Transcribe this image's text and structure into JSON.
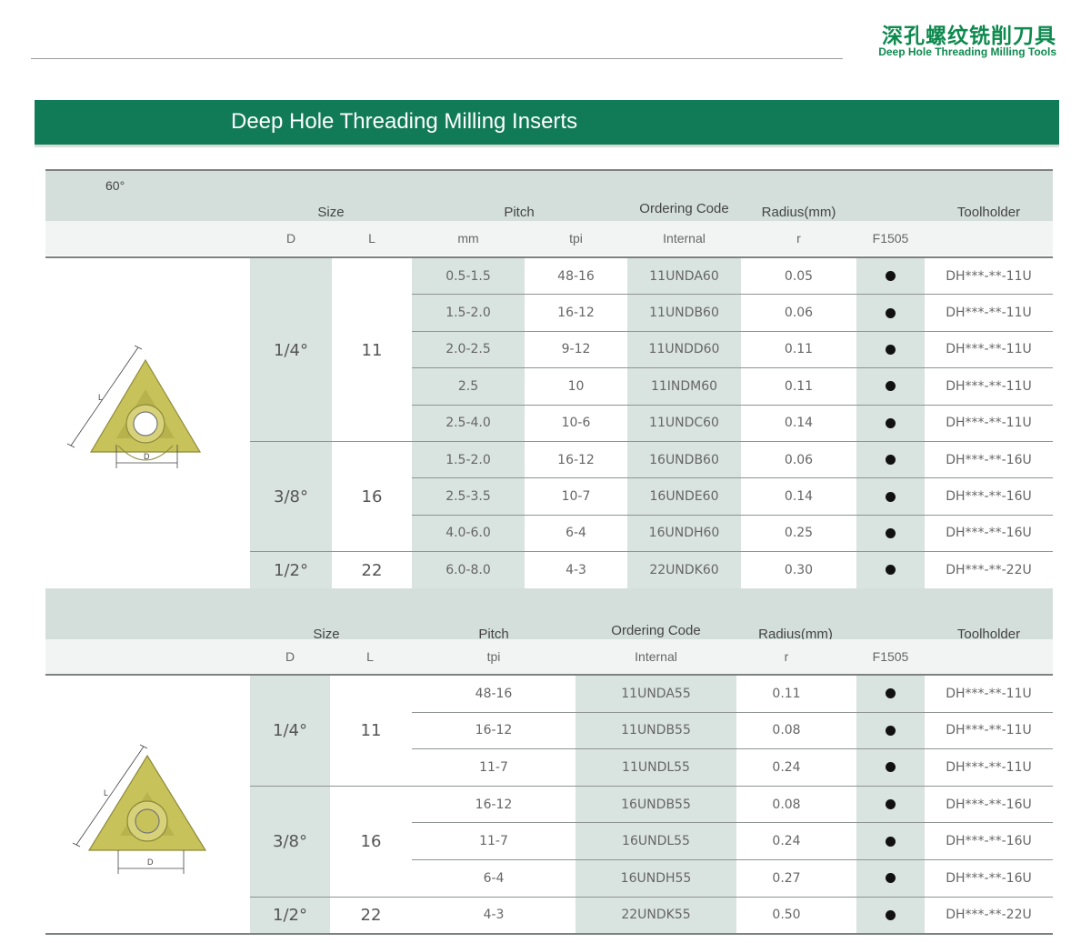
{
  "header": {
    "title_cn": "深孔螺纹铣削刀具",
    "subtitle": "Deep Hole Threading Milling Tools"
  },
  "banner": {
    "title": "Deep Hole Threading Milling Inserts"
  },
  "colors": {
    "brand_green": "#117a57",
    "header_green": "#0e8a4f",
    "header_band": "#d4dfdb",
    "cell_shade": "#d9e3df"
  },
  "table1": {
    "angle": "60°",
    "headers": {
      "size": "Size",
      "pitch": "Pitch",
      "ordering_code": "Ordering Code",
      "radius": "Radius(mm)",
      "toolholder": "Toolholder"
    },
    "subheaders": {
      "d": "D",
      "l": "L",
      "mm": "mm",
      "tpi": "tpi",
      "internal": "Internal",
      "r": "r",
      "grade": "F1505"
    },
    "image_labels": {
      "l": "L",
      "d": "D"
    },
    "groups": [
      {
        "d": "1/4°",
        "l": "11",
        "rows": 5
      },
      {
        "d": "3/8°",
        "l": "16",
        "rows": 3
      },
      {
        "d": "1/2°",
        "l": "22",
        "rows": 1
      }
    ],
    "rows": [
      {
        "mm": "0.5-1.5",
        "tpi": "48-16",
        "code": "11UNDA60",
        "r": "0.05",
        "toolholder": "DH***-**-11U"
      },
      {
        "mm": "1.5-2.0",
        "tpi": "16-12",
        "code": "11UNDB60",
        "r": "0.06",
        "toolholder": "DH***-**-11U"
      },
      {
        "mm": "2.0-2.5",
        "tpi": "9-12",
        "code": "11UNDD60",
        "r": "0.11",
        "toolholder": "DH***-**-11U"
      },
      {
        "mm": "2.5",
        "tpi": "10",
        "code": "11INDM60",
        "r": "0.11",
        "toolholder": "DH***-**-11U"
      },
      {
        "mm": "2.5-4.0",
        "tpi": "10-6",
        "code": "11UNDC60",
        "r": "0.14",
        "toolholder": "DH***-**-11U"
      },
      {
        "mm": "1.5-2.0",
        "tpi": "16-12",
        "code": "16UNDB60",
        "r": "0.06",
        "toolholder": "DH***-**-16U"
      },
      {
        "mm": "2.5-3.5",
        "tpi": "10-7",
        "code": "16UNDE60",
        "r": "0.14",
        "toolholder": "DH***-**-16U"
      },
      {
        "mm": "4.0-6.0",
        "tpi": "6-4",
        "code": "16UNDH60",
        "r": "0.25",
        "toolholder": "DH***-**-16U"
      },
      {
        "mm": "6.0-8.0",
        "tpi": "4-3",
        "code": "22UNDK60",
        "r": "0.30",
        "toolholder": "DH***-**-22U"
      }
    ]
  },
  "table2": {
    "headers": {
      "size": "Size",
      "pitch": "Pitch",
      "ordering_code": "Ordering Code",
      "radius": "Radius(mm)",
      "toolholder": "Toolholder"
    },
    "subheaders": {
      "d": "D",
      "l": "L",
      "tpi": "tpi",
      "internal": "Internal",
      "r": "r",
      "grade": "F1505"
    },
    "image_labels": {
      "l": "L",
      "d": "D"
    },
    "groups": [
      {
        "d": "1/4°",
        "l": "11",
        "rows": 3
      },
      {
        "d": "3/8°",
        "l": "16",
        "rows": 3
      },
      {
        "d": "1/2°",
        "l": "22",
        "rows": 1
      }
    ],
    "rows": [
      {
        "tpi": "48-16",
        "code": "11UNDA55",
        "r": "0.11",
        "toolholder": "DH***-**-11U"
      },
      {
        "tpi": "16-12",
        "code": "11UNDB55",
        "r": "0.08",
        "toolholder": "DH***-**-11U"
      },
      {
        "tpi": "11-7",
        "code": "11UNDL55",
        "r": "0.24",
        "toolholder": "DH***-**-11U"
      },
      {
        "tpi": "16-12",
        "code": "16UNDB55",
        "r": "0.08",
        "toolholder": "DH***-**-16U"
      },
      {
        "tpi": "11-7",
        "code": "16UNDL55",
        "r": "0.24",
        "toolholder": "DH***-**-16U"
      },
      {
        "tpi": "6-4",
        "code": "16UNDH55",
        "r": "0.27",
        "toolholder": "DH***-**-16U"
      },
      {
        "tpi": "4-3",
        "code": "22UNDK55",
        "r": "0.50",
        "toolholder": "DH***-**-22U"
      }
    ]
  }
}
